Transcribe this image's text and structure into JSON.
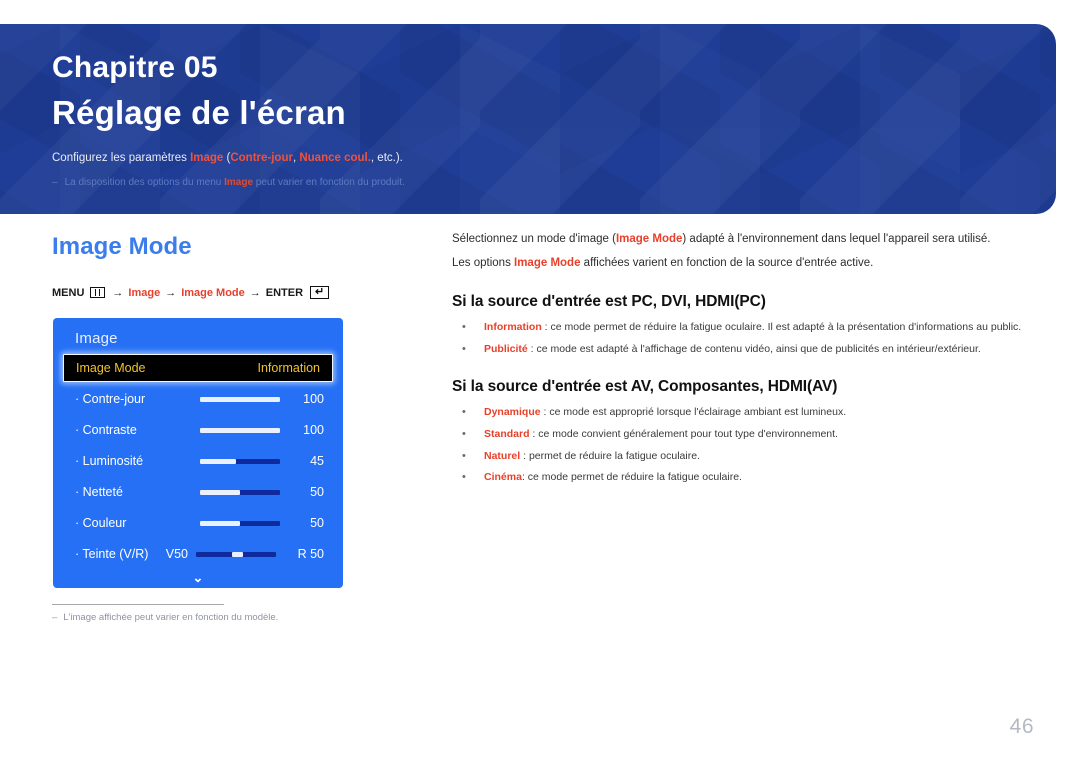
{
  "banner": {
    "chapter": "Chapitre 05",
    "title": "Réglage de l'écran",
    "desc_pre": "Configurez les paramètres ",
    "desc_hl1": "Image",
    "desc_mid": " (",
    "desc_hl2": "Contre-jour",
    "desc_sep": ", ",
    "desc_hl3": "Nuance coul.",
    "desc_post": ", etc.).",
    "note_dash": "‒",
    "note_pre": "La disposition des options du menu ",
    "note_hl": "Image",
    "note_post": " peut varier en fonction du produit.",
    "bg_color": "#1f3d96"
  },
  "section": {
    "title": "Image Mode",
    "title_color": "#3b7ded"
  },
  "breadcrumb": {
    "menu_label": "MENU",
    "menu_icon": "menu-grid-icon",
    "arrow1": "→",
    "item1": "Image",
    "arrow2": "→",
    "item2": "Image Mode",
    "arrow3": "→",
    "enter_label": "ENTER",
    "enter_icon": "↵",
    "accent": "#e8402a"
  },
  "osd": {
    "header": "Image",
    "chevron": "⌄",
    "selected": {
      "label": "Image Mode",
      "value": "Information",
      "text_color": "#f0c32c",
      "bg_color": "#000000"
    },
    "rows": [
      {
        "label": "· Contre-jour",
        "value": "100",
        "fill_pct": 100
      },
      {
        "label": "· Contraste",
        "value": "100",
        "fill_pct": 100
      },
      {
        "label": "· Luminosité",
        "value": "45",
        "fill_pct": 45
      },
      {
        "label": "· Netteté",
        "value": "50",
        "fill_pct": 50
      },
      {
        "label": "· Couleur",
        "value": "50",
        "fill_pct": 50
      }
    ],
    "tint_row": {
      "label": "· Teinte (V/R)",
      "left_value": "V50",
      "right_value": "R 50"
    },
    "bg_color": "#2570f5"
  },
  "footnote": {
    "dash": "‒",
    "text": "L'image affichée peut varier en fonction du modèle."
  },
  "right": {
    "intro": [
      {
        "pre": "Sélectionnez un mode d'image (",
        "hl": "Image Mode",
        "post": ") adapté à l'environnement dans lequel l'appareil sera utilisé."
      },
      {
        "pre": "Les options ",
        "hl": "Image Mode",
        "post": " affichées varient en fonction de la source d'entrée active."
      }
    ],
    "sections": [
      {
        "heading": "Si la source d'entrée est PC, DVI, HDMI(PC)",
        "items": [
          {
            "term": "Information",
            "desc": " : ce mode permet de réduire la fatigue oculaire. Il est adapté à la présentation d'informations au public."
          },
          {
            "term": "Publicité",
            "desc": " : ce mode est adapté à l'affichage de contenu vidéo, ainsi que de publicités en intérieur/extérieur."
          }
        ]
      },
      {
        "heading": "Si la source d'entrée est AV, Composantes, HDMI(AV)",
        "items": [
          {
            "term": "Dynamique",
            "desc": " : ce mode est approprié lorsque l'éclairage ambiant est lumineux."
          },
          {
            "term": "Standard",
            "desc": " : ce mode convient généralement pour tout type d'environnement."
          },
          {
            "term": "Naturel",
            "desc": " : permet de réduire la fatigue oculaire."
          },
          {
            "term": "Cinéma",
            "desc": ": ce mode permet de réduire la fatigue oculaire."
          }
        ]
      }
    ]
  },
  "page_number": "46"
}
